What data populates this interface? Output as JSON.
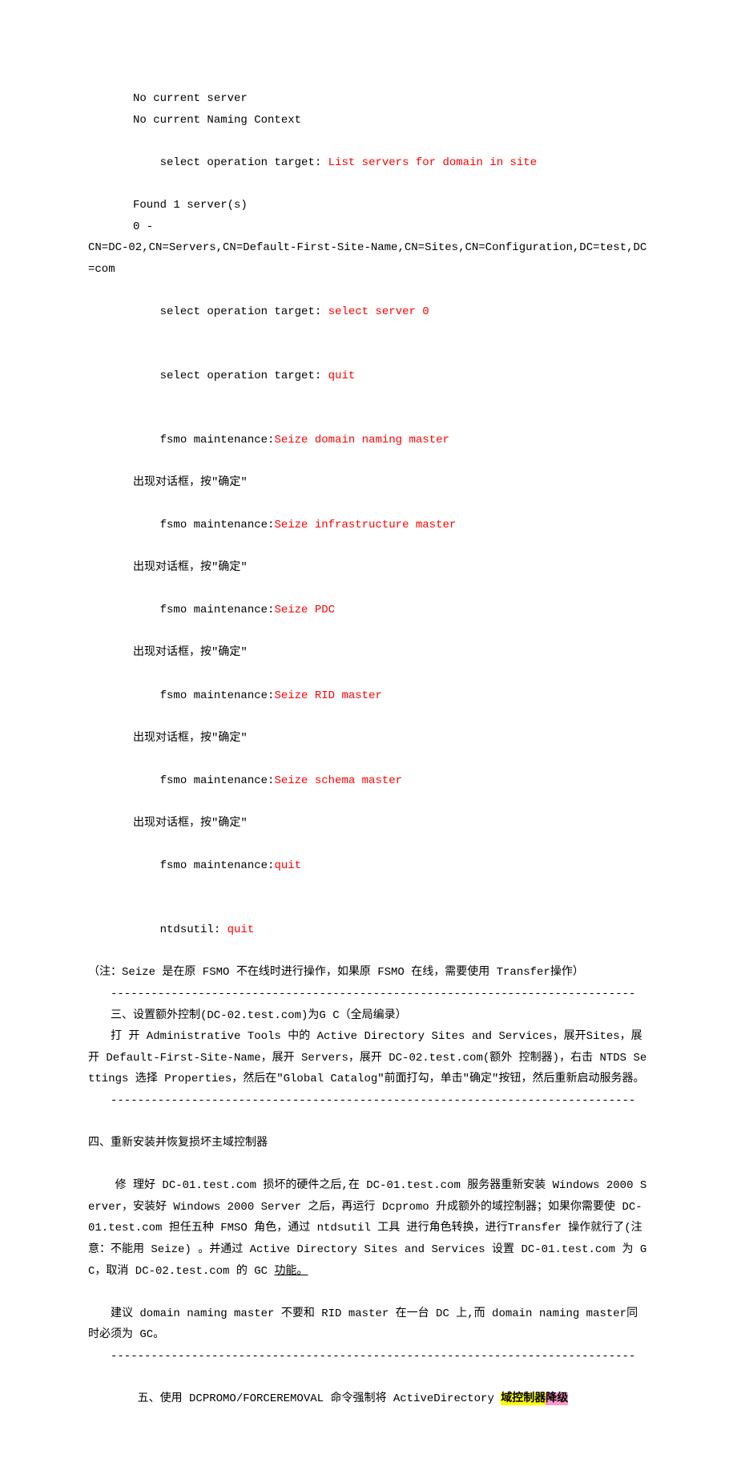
{
  "doc": {
    "lines": {
      "l1": "No current server",
      "l2": "No current Naming Context",
      "l3a": "select operation target: ",
      "l3b": "List servers for domain in site",
      "l4": "Found 1 server(s)",
      "l5": "0 -",
      "l6": "CN=DC-02,CN=Servers,CN=Default-First-Site-Name,CN=Sites,CN=Configuration,DC=test,DC=com",
      "l7a": "select operation target: ",
      "l7b": "select server 0",
      "l8a": "select operation target: ",
      "l8b": "quit",
      "l9a": "fsmo maintenance:",
      "l9b": "Seize domain naming master",
      "l10": "出现对话框，按\"确定\"",
      "l11a": "fsmo maintenance:",
      "l11b": "Seize infrastructure master",
      "l12": "出现对话框，按\"确定\"",
      "l13a": "fsmo maintenance:",
      "l13b": "Seize PDC",
      "l14": "出现对话框，按\"确定\"",
      "l15a": "fsmo maintenance:",
      "l15b": "Seize RID master",
      "l16": "出现对话框，按\"确定\"",
      "l17a": "fsmo maintenance:",
      "l17b": "Seize schema master",
      "l18": "出现对话框，按\"确定\"",
      "l19a": "fsmo maintenance:",
      "l19b": "quit",
      "l20a": "ntdsutil: ",
      "l20b": "quit",
      "l21": "（注：Seize 是在原 FSMO 不在线时进行操作，如果原 FSMO 在线，需要使用 Transfer操作）",
      "sep": "------------------------------------------------------------------------------",
      "s3title": "三、设置额外控制(DC-02.test.com)为G C（全局编录）",
      "s3body": "打 开 Administrative Tools 中的 Active Directory Sites and Services，展开Sites，展开 Default-First-Site-Name，展开 Servers，展开 DC-02.test.com(额外 控制器)，右击 NTDS Settings 选择 Properties，然后在\"Global Catalog\"前面打勾，单击\"确定\"按钮，然后重新启动服务器。",
      "s4title": "四、重新安装并恢复损坏主域控制器",
      "s4body1a": "修 理好 DC-01.test.com 损坏的硬件之后,在 DC-01.test.com 服务器重新安装 Windows 2000 Server，安装好 Windows 2000 Server 之后，再运行 Dcpromo 升成额外的域控制器；如果你需要使 DC-01.test.com 担任五种 FMSO 角色，通过 ntdsutil 工具 进行角色转换，进行Transfer 操作就行了(注意：不能用 Seize) 。并通过 Active Directory Sites and Services 设置 DC-01.test.com 为 GC，取消 DC-02.test.com 的 GC ",
      "s4body1b": "功能。",
      "s4body2": "建议 domain naming master 不要和 RID master 在一台 DC 上,而 domain naming master同时必须为 GC。",
      "s5a": "五、使用 DCPROMO/FORCEREMOVAL 命令强制将 ActiveDirectory ",
      "s5b": "域控制器",
      "s5c": "降级"
    }
  }
}
